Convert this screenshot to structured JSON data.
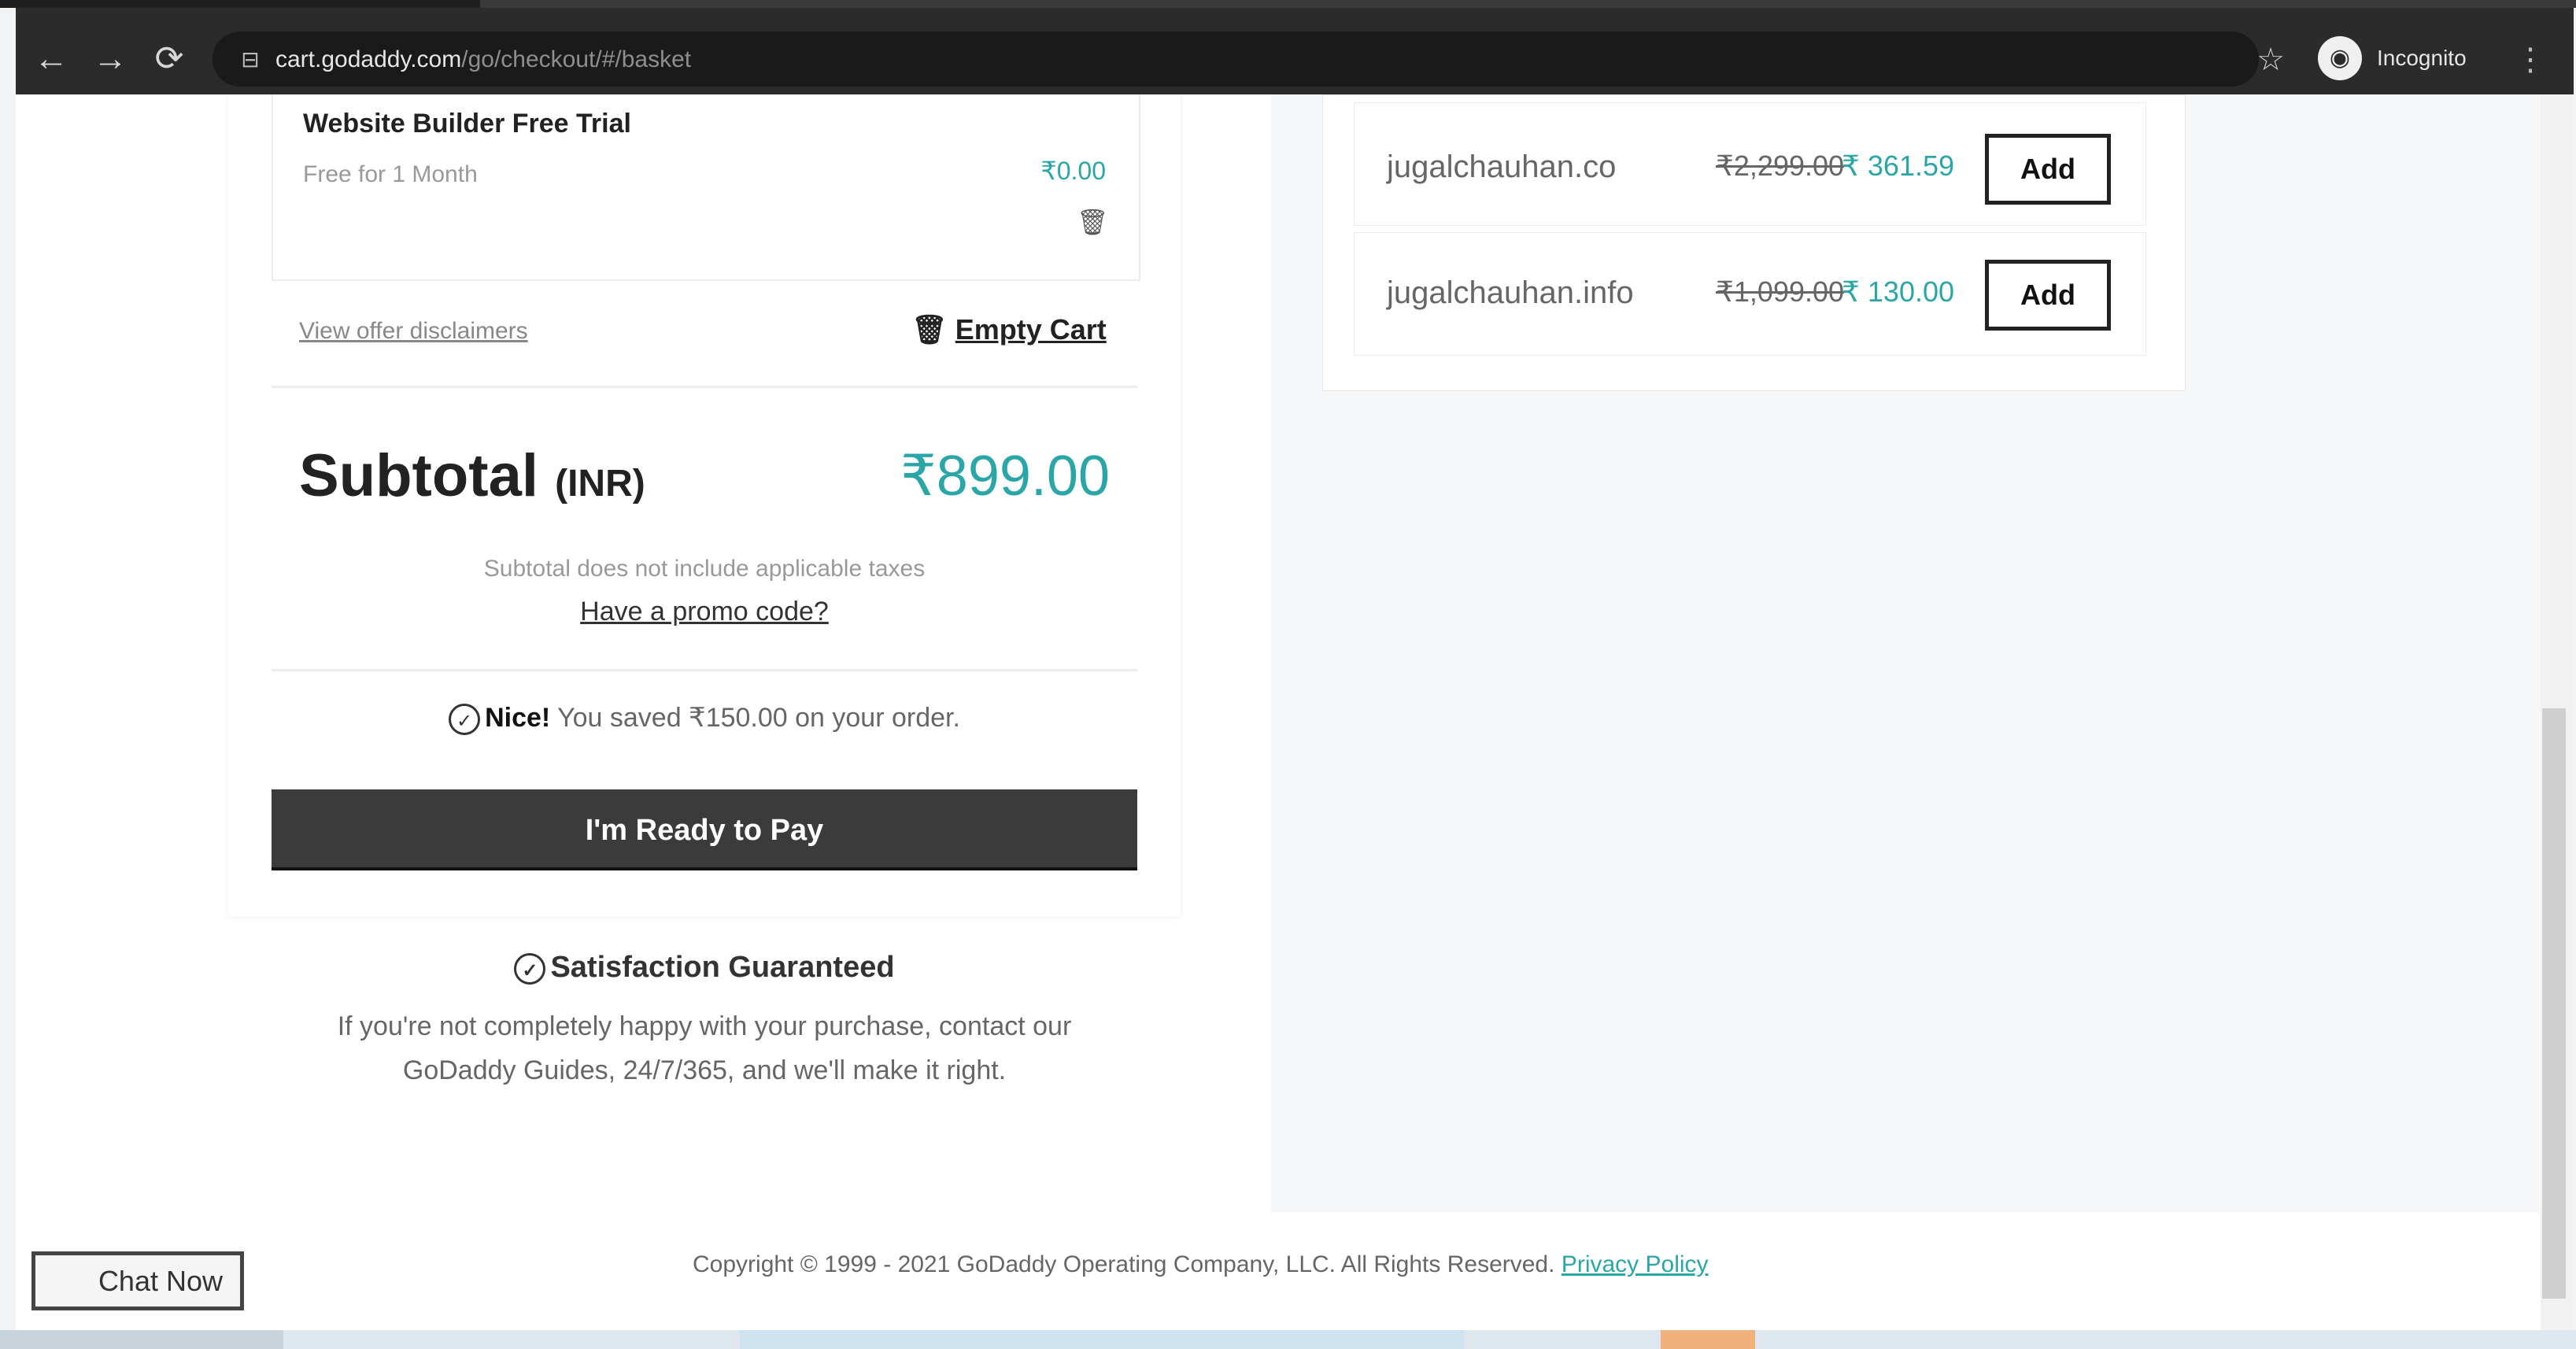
{
  "browser": {
    "url_host": "cart.godaddy.com",
    "url_path": "/go/checkout/#/basket",
    "profile_label": "Incognito",
    "icons": [
      "back-arrow-icon",
      "forward-arrow-icon",
      "reload-icon",
      "site-info-icon",
      "star-icon",
      "incognito-icon",
      "kebab-menu-icon"
    ]
  },
  "cart": {
    "item": {
      "title": "Website Builder Free Trial",
      "subtitle": "Free for 1 Month",
      "price": "₹0.00"
    },
    "offer_disclaimers": "View offer disclaimers",
    "empty_cart": "Empty Cart",
    "subtotal_label": "Subtotal",
    "subtotal_currency": "(INR)",
    "subtotal_value": "₹899.00",
    "taxes_note": "Subtotal does not include applicable taxes",
    "promo_link": "Have a promo code?",
    "savings_nice": "Nice!",
    "savings_text": "You saved ₹150.00 on your order.",
    "pay_button": "I'm Ready to Pay"
  },
  "guarantee": {
    "title": "Satisfaction Guaranteed",
    "body": "If you're not completely happy with your purchase, contact our GoDaddy Guides, 24/7/365, and we'll make it right."
  },
  "upsell": [
    {
      "domain": "jugalchauhan.co",
      "old_price": "₹2,299.00",
      "new_price": "₹ 361.59",
      "button": "Add"
    },
    {
      "domain": "jugalchauhan.info",
      "old_price": "₹1,099.00",
      "new_price": "₹ 130.00",
      "button": "Add"
    }
  ],
  "footer": {
    "copyright": "Copyright © 1999 - 2021 GoDaddy Operating Company, LLC. All Rights Reserved.",
    "privacy": "Privacy Policy"
  },
  "chat_button": "Chat Now",
  "colors": {
    "accent": "#2ba6a7",
    "pay_button": "#3b3b3b",
    "chrome": "#2b2b2b"
  }
}
